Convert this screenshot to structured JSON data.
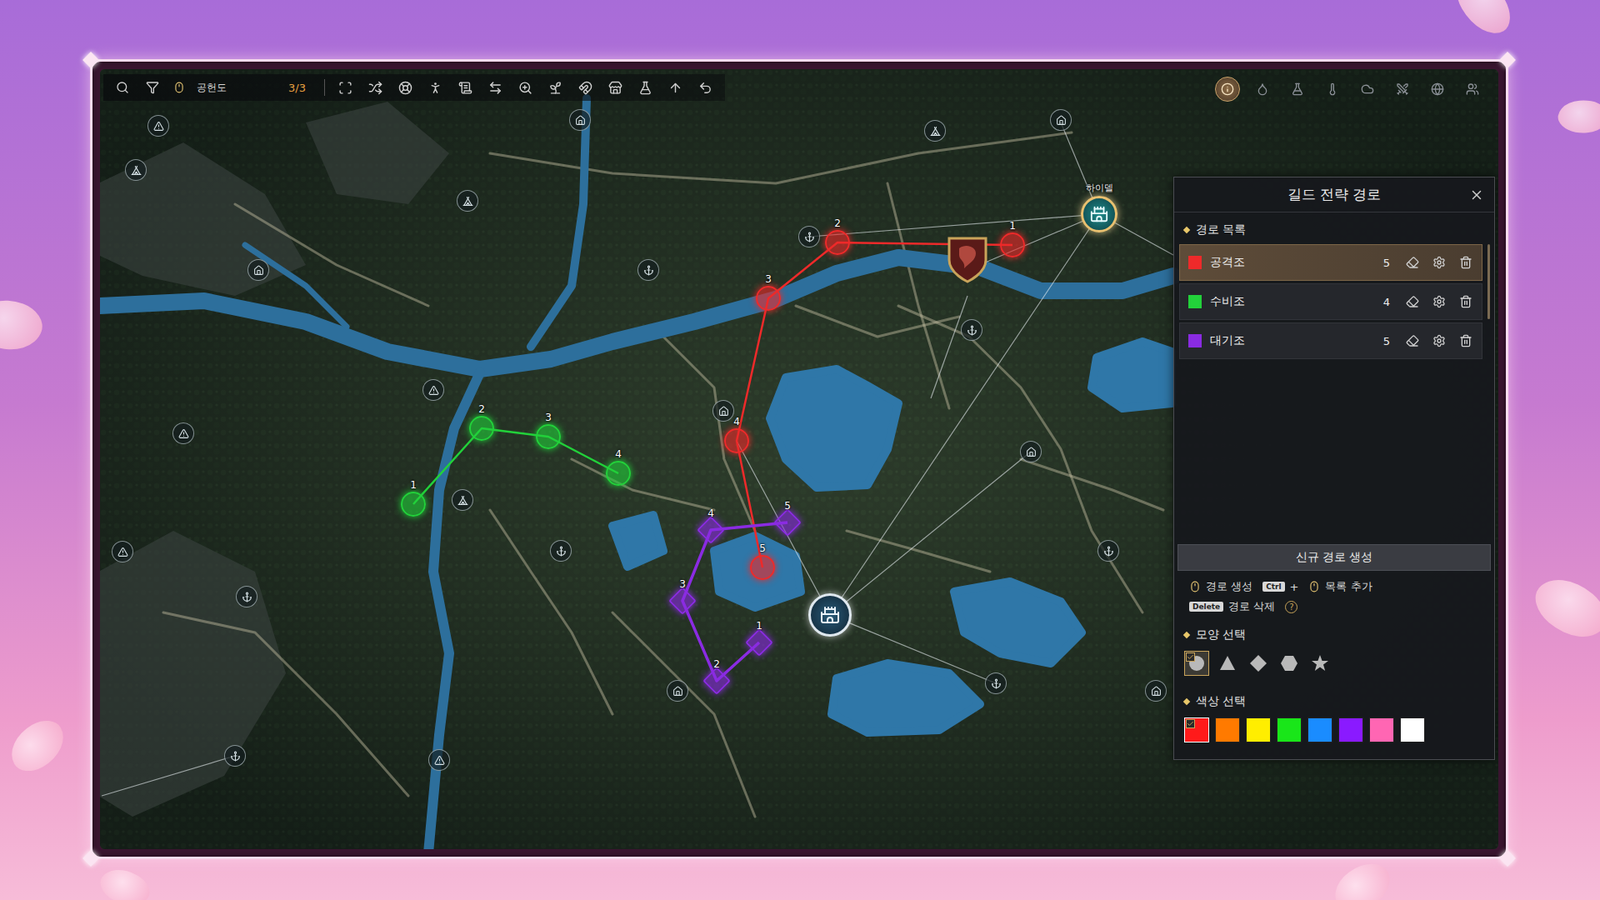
{
  "toolbar": {
    "filter_label": "공헌도",
    "count": "3/3"
  },
  "view_toggles": [
    {
      "selected": true
    },
    {
      "selected": false
    },
    {
      "selected": false
    },
    {
      "selected": false
    },
    {
      "selected": false
    },
    {
      "selected": false
    },
    {
      "selected": false
    },
    {
      "selected": false
    }
  ],
  "map": {
    "town_label": "하이델"
  },
  "panel": {
    "title": "길드 전략 경로",
    "list_title": "경로 목록",
    "routes": [
      {
        "name": "공격조",
        "count": "5",
        "color": "#ee2a2a",
        "selected": true,
        "shape": "circle",
        "points": [
          "1",
          "2",
          "3",
          "4",
          "5"
        ]
      },
      {
        "name": "수비조",
        "count": "4",
        "color": "#22d13a",
        "selected": false,
        "shape": "circle",
        "points": [
          "1",
          "2",
          "3",
          "4"
        ]
      },
      {
        "name": "대기조",
        "count": "5",
        "color": "#8a2be2",
        "selected": false,
        "shape": "diamond",
        "points": [
          "1",
          "2",
          "3",
          "4",
          "5"
        ]
      }
    ],
    "new_route_button": "신규 경로 생성",
    "instructions": [
      [
        {
          "kind": "mouse"
        },
        {
          "kind": "text",
          "text": "경로 생성"
        },
        {
          "kind": "key",
          "text": "Ctrl"
        },
        {
          "kind": "text",
          "text": "+"
        },
        {
          "kind": "mouse"
        },
        {
          "kind": "text",
          "text": "목록 추가"
        }
      ],
      [
        {
          "kind": "key",
          "text": "Delete"
        },
        {
          "kind": "text",
          "text": "경로 삭제"
        },
        {
          "kind": "help",
          "text": "?"
        }
      ]
    ],
    "shape_title": "모양 선택",
    "shapes": [
      {
        "kind": "circle",
        "selected": true
      },
      {
        "kind": "triangle",
        "selected": false
      },
      {
        "kind": "diamond",
        "selected": false
      },
      {
        "kind": "hexagon",
        "selected": false
      },
      {
        "kind": "star",
        "selected": false
      }
    ],
    "color_title": "색상 선택",
    "colors": [
      {
        "color": "#ff1a1a",
        "selected": true
      },
      {
        "color": "#ff7a00",
        "selected": false
      },
      {
        "color": "#ffee00",
        "selected": false
      },
      {
        "color": "#19e619",
        "selected": false
      },
      {
        "color": "#1a8cff",
        "selected": false
      },
      {
        "color": "#8a1aff",
        "selected": false
      },
      {
        "color": "#ff66b3",
        "selected": false
      },
      {
        "color": "#ffffff",
        "selected": false
      }
    ]
  }
}
